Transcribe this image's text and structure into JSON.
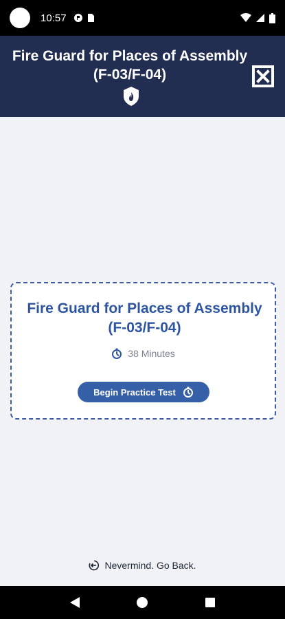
{
  "status_bar": {
    "time": "10:57"
  },
  "header": {
    "title": "Fire Guard for Places of Assembly (F-03/F-04)",
    "close_icon": "close-icon",
    "badge_icon": "fire-shield-icon"
  },
  "card": {
    "title": "Fire Guard for Places of Assembly (F-03/F-04)",
    "duration": "38 Minutes",
    "duration_icon": "stopwatch-icon",
    "begin_label": "Begin Practice Test",
    "begin_icon": "stopwatch-icon"
  },
  "footer": {
    "go_back_label": "Nevermind. Go Back.",
    "go_back_icon": "arrow-left-circle-icon"
  },
  "colors": {
    "header_bg": "#222d52",
    "accent": "#3560a7",
    "title_blue": "#2e55a0",
    "page_bg": "#f1f2f6"
  }
}
